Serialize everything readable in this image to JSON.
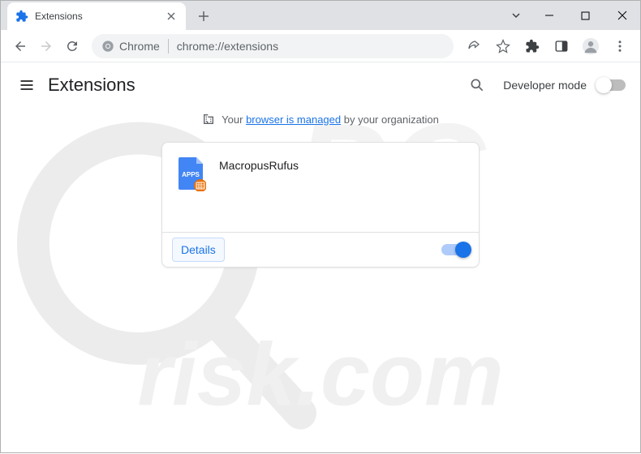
{
  "tab": {
    "title": "Extensions"
  },
  "omnibox": {
    "chip": "Chrome",
    "url": "chrome://extensions"
  },
  "page": {
    "title": "Extensions",
    "developer_mode_label": "Developer mode",
    "managed_prefix": "Your",
    "managed_link": "browser is managed",
    "managed_suffix": "by your organization"
  },
  "extension": {
    "name": "MacropusRufus",
    "details_label": "Details",
    "enabled": true,
    "icon_badge_text": "APPS"
  }
}
